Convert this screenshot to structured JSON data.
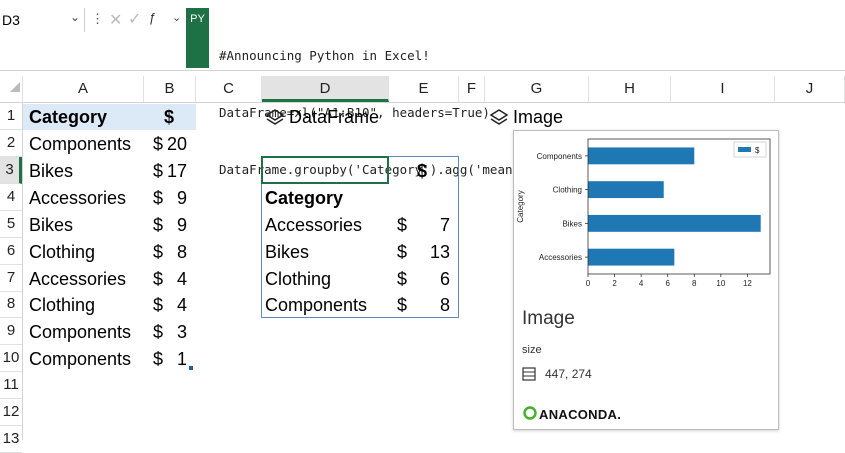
{
  "formula_bar": {
    "name_box": "D3",
    "py_badge": "PY",
    "formula_lines": [
      "#Announcing Python in Excel!",
      "DataFrame=xl(\"A1:B10\", headers=True)",
      "DataFrame.groupby('Category').agg('mean')"
    ]
  },
  "columns": [
    "A",
    "B",
    "C",
    "D",
    "E",
    "F",
    "G",
    "H",
    "I",
    "J"
  ],
  "rows": [
    "1",
    "2",
    "3",
    "4",
    "5",
    "6",
    "7",
    "8",
    "9",
    "10",
    "11",
    "12",
    "13"
  ],
  "selected_column": "D",
  "selected_row": "3",
  "sheet": {
    "header": {
      "category": "Category",
      "amount": "$"
    },
    "records": [
      {
        "category": "Components",
        "cur": "$",
        "amount": "20"
      },
      {
        "category": "Bikes",
        "cur": "$",
        "amount": "17"
      },
      {
        "category": "Accessories",
        "cur": "$",
        "amount": "9"
      },
      {
        "category": "Bikes",
        "cur": "$",
        "amount": "9"
      },
      {
        "category": "Clothing",
        "cur": "$",
        "amount": "8"
      },
      {
        "category": "Accessories",
        "cur": "$",
        "amount": "4"
      },
      {
        "category": "Clothing",
        "cur": "$",
        "amount": "4"
      },
      {
        "category": "Components",
        "cur": "$",
        "amount": "3"
      },
      {
        "category": "Components",
        "cur": "$",
        "amount": "1"
      }
    ]
  },
  "dataframe": {
    "label": "DataFrame",
    "value_header": "$",
    "index_name": "Category",
    "rows": [
      {
        "category": "Accessories",
        "cur": "$",
        "value": "7"
      },
      {
        "category": "Bikes",
        "cur": "$",
        "value": "13"
      },
      {
        "category": "Clothing",
        "cur": "$",
        "value": "6"
      },
      {
        "category": "Components",
        "cur": "$",
        "value": "8"
      }
    ]
  },
  "image_card": {
    "label": "Image",
    "title": "Image",
    "size_label": "size",
    "size_value": "447, 274",
    "brand": "ANACONDA."
  },
  "chart_data": {
    "type": "bar",
    "orientation": "horizontal",
    "categories": [
      "Accessories",
      "Bikes",
      "Clothing",
      "Components"
    ],
    "series": [
      {
        "name": "$",
        "values": [
          6.5,
          13,
          5.7,
          8
        ]
      }
    ],
    "xlabel": "",
    "ylabel": "Category",
    "xticks": [
      0,
      2,
      4,
      6,
      8,
      10,
      12
    ],
    "xlim": [
      0,
      13.7
    ],
    "grid": false,
    "legend": "top-right",
    "colors": {
      "bar": "#1f77b4"
    }
  },
  "colors": {
    "accent": "#1e7145",
    "header_fill": "#dce9f6",
    "spill_border": "#5b8bc4"
  }
}
